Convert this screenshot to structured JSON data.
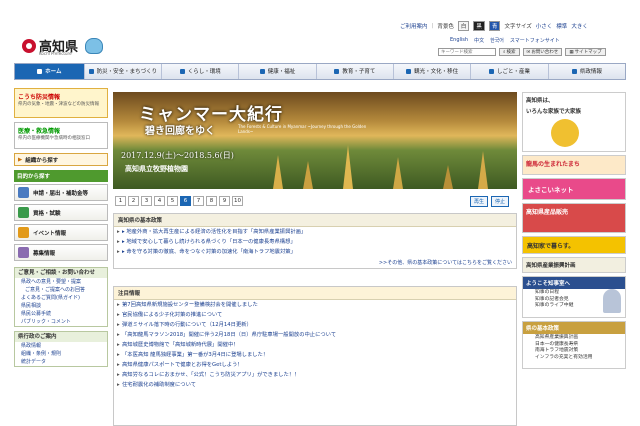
{
  "header": {
    "site_name": "高知県",
    "site_sub": "Kochi Prefecture",
    "top_links": [
      "ご利用案内",
      "背景色",
      "白",
      "黒",
      "青",
      "文字サイズ",
      "小さく",
      "標準",
      "大きく"
    ],
    "lang_links": [
      "English",
      "中文",
      "한국어",
      "スマートフォンサイト"
    ],
    "search_placeholder": "キーワード検索",
    "search_btn": "検索",
    "faq_btn": "お問い合わせ",
    "sitemap_btn": "サイトマップ"
  },
  "nav": [
    "ホーム",
    "防災・安全・まちづくり",
    "くらし・環境",
    "健康・福祉",
    "教育・子育て",
    "観光・文化・移住",
    "しごと・産業",
    "県政情報"
  ],
  "left": {
    "bosai_title": "こうち防災情報",
    "bosai_sub": "県内の気象・地震・津波などの防災情報",
    "kyukyu_title": "医療・救急情報",
    "kyukyu_sub": "県内の医療機関や急病時の相談窓口",
    "search_org": "組織から探す",
    "purpose_head": "目的から探す",
    "purpose": [
      "申請・届出・補助金等",
      "資格・試験",
      "イベント情報",
      "募集情報"
    ],
    "opinion_head": "ご意見・ご相談・お問い合わせ",
    "opinion_links": [
      "県政への意見・要望・提案",
      "ご意見・ご提案へのお回答",
      "よくあるご質問(県ガイド)",
      "県民相談",
      "県民公募手続",
      "パブリック・コメント"
    ],
    "intro_head": "県行政のご案内",
    "intro_links": [
      "県政情報",
      "組織・条例・規則",
      "統計データ"
    ]
  },
  "banner": {
    "title": "ミャンマー大紀行",
    "subtitle": "碧き回廊をゆく",
    "en": "The Forests & Culture in Myanmar ~Journey through the Golden Lands~",
    "date": "2017.12.9(土)～2018.5.6(日)",
    "museum": "高知県立牧野植物園"
  },
  "pager": [
    "1",
    "2",
    "3",
    "4",
    "5",
    "6",
    "7",
    "8",
    "9",
    "10"
  ],
  "pager_active": "6",
  "play": "再生",
  "stop": "停止",
  "policy": {
    "head": "高知県の基本政策",
    "rows": [
      "▸ 地産外商・拡大再生産による経済の活性化を目指す「高知県産業振興計画」",
      "▸ 地域で安心して暮らし続けられる県づくり「日本一の健康長寿県構想」",
      "▸ 命を守る対策の徹底、命をつなぐ対策の加速化「南海トラフ地震対策」"
    ],
    "more": ">>その他、県の基本政策についてはこちらをご覧ください"
  },
  "news": {
    "head": "注目情報",
    "rows": [
      "第7回高知県新規施設センター整備検討会を開催しました",
      "官民協働による少子化対策の推進について",
      "弾道ミサイル落下時の行動について（12月14日更新）",
      "「高知龍馬マラソン2018」開催に伴う2月18日（日）県庁駐車場一般開放の中止について",
      "高知城歴史博物館で「高知城新時代展」開催中！",
      "「本医高知 龍馬独経事業」第一番が3月4日に登場しました！",
      "高知県健康パスポートで健康とお得をGetしよう！",
      "高知労なるコレにおまかせ、「公式！こうち防災アプリ」ができました！！",
      "住宅耐震化の補助制度について"
    ]
  },
  "right": {
    "top": [
      "高知県は、",
      "いろんな家族で大家族"
    ],
    "banners": [
      "龍馬の生まれたまち",
      "よさこいネット",
      "高知県産品販売",
      "高知家で暮らす。",
      "高知県産業振興計画"
    ],
    "gov_head": "ようこそ知事室へ",
    "gov_links": [
      "知事の日程",
      "知事の記者会見",
      "知事のライブ中継"
    ],
    "policy_head": "県の基本政策",
    "policy_links": [
      "高知県産業振興計画",
      "日本一の健康長寿県",
      "南海トラフ地震対策",
      "インフラの充実と有効活用"
    ]
  }
}
